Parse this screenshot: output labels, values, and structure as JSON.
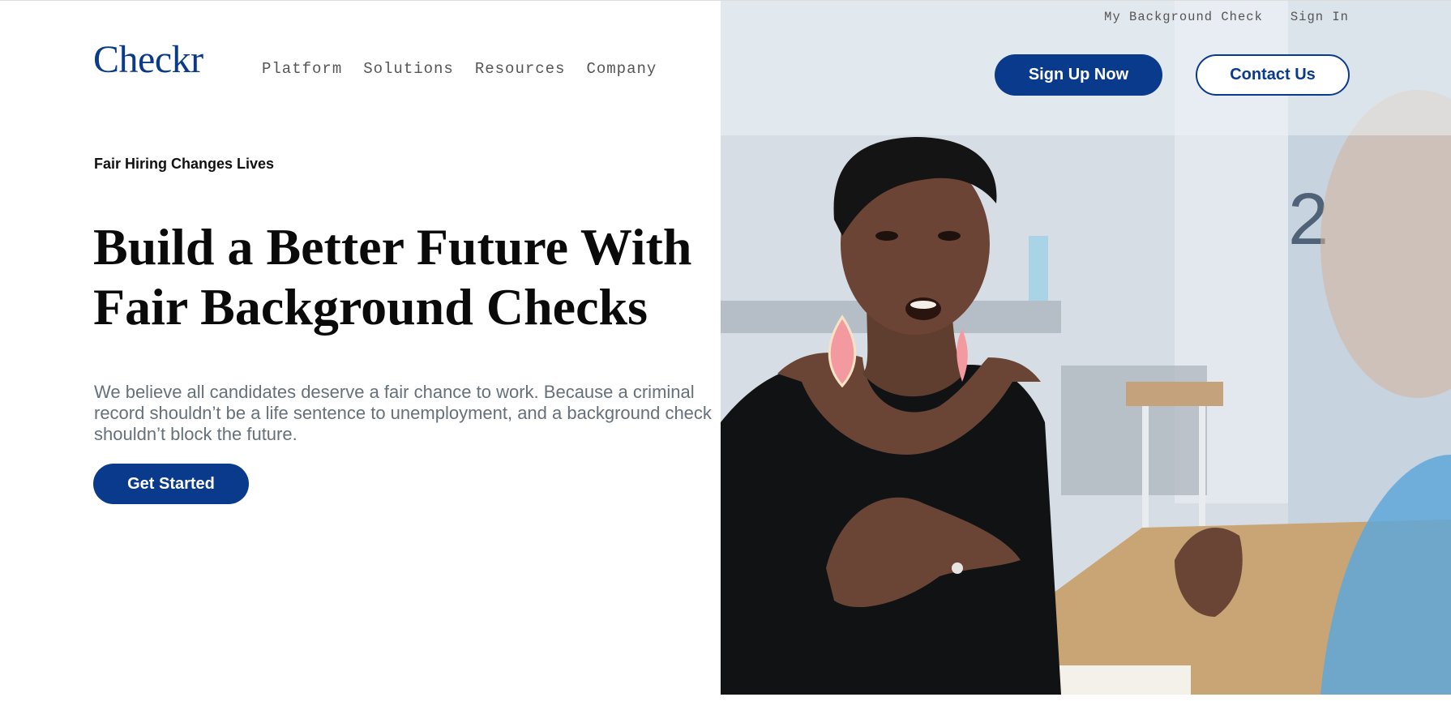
{
  "brand": {
    "logo_text": "Checkr",
    "color": "#0a3a8c"
  },
  "main_nav": {
    "items": [
      {
        "label": "Platform"
      },
      {
        "label": "Solutions"
      },
      {
        "label": "Resources"
      },
      {
        "label": "Company"
      }
    ]
  },
  "utility_nav": {
    "items": [
      {
        "label": "My Background Check"
      },
      {
        "label": "Sign In"
      }
    ]
  },
  "header_buttons": {
    "signup_label": "Sign Up Now",
    "contact_label": "Contact Us"
  },
  "hero": {
    "eyebrow": "Fair Hiring Changes Lives",
    "headline_line1": "Build a Better Future With",
    "headline_line2": "Fair Background Checks",
    "body": "We believe all candidates deserve a fair chance to work. Because a criminal record shouldn’t be a life sentence to unemployment, and a background check shouldn’t block the future.",
    "cta_label": "Get Started"
  },
  "colors": {
    "primary": "#0a3a8c",
    "body_text": "#66707a",
    "nav_text": "#555555"
  }
}
